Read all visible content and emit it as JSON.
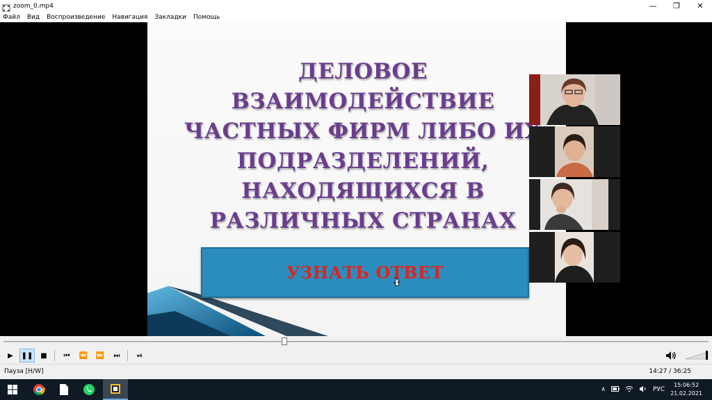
{
  "window": {
    "title": "zoom_0.mp4",
    "minimize": "—",
    "restore": "❐",
    "close": "✕"
  },
  "menu": [
    "Файл",
    "Вид",
    "Воспроизведение",
    "Навигация",
    "Закладки",
    "Помощь"
  ],
  "slide": {
    "title_lines": [
      "ДЕЛОВОЕ",
      "ВЗАИМОДЕЙСТВИЕ",
      "ЧАСТНЫХ ФИРМ ЛИБО ИХ",
      "ПОДРАЗДЕЛЕНИЙ,",
      "НАХОДЯЩИХСЯ В",
      "РАЗЛИЧНЫХ СТРАНАХ"
    ],
    "answer_button": "УЗНАТЬ ОТВЕТ",
    "title_color": "#6a3d8e",
    "button_color": "#2b8dbd",
    "button_text_color": "#e0231c"
  },
  "participants": [
    {
      "name": "participant-1"
    },
    {
      "name": "participant-2"
    },
    {
      "name": "participant-3"
    },
    {
      "name": "participant-4"
    }
  ],
  "playback": {
    "progress": 0.398,
    "status": "Пауза [H/W]",
    "time": "14:27 / 36:25",
    "buttons": {
      "play": "▶",
      "pause": "❚❚",
      "stop": "■",
      "prev": "⏮",
      "rewind": "⏪",
      "forward": "⏩",
      "next": "⏭",
      "frame": "⏯"
    }
  },
  "taskbar": {
    "language": "РУС",
    "time": "15:06:52",
    "date": "21.02.2021",
    "tray_arrow": "∧"
  }
}
